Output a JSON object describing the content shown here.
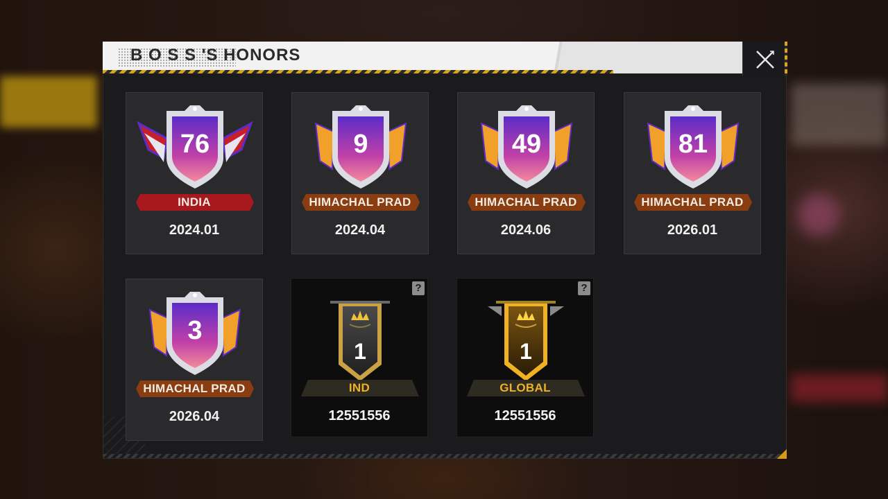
{
  "window": {
    "title": "B O S S 'S HONORS",
    "close_icon": "close-icon"
  },
  "colors": {
    "accent_gold": "#d8a51a",
    "ribbon_red": "#a8191e",
    "ribbon_orange": "#8a3d10",
    "badge_purple": "#6a2fc4",
    "badge_pink": "#e05a9e"
  },
  "honors": [
    {
      "rank": "76",
      "region": "INDIA",
      "date": "2024.01",
      "style": "red-wings"
    },
    {
      "rank": "9",
      "region": "HIMACHAL PRAD",
      "date": "2024.04",
      "style": "gold-wings"
    },
    {
      "rank": "49",
      "region": "HIMACHAL PRAD",
      "date": "2024.06",
      "style": "gold-wings"
    },
    {
      "rank": "81",
      "region": "HIMACHAL PRAD",
      "date": "2026.01",
      "style": "gold-wings"
    },
    {
      "rank": "3",
      "region": "HIMACHAL PRAD",
      "date": "2026.04",
      "style": "gold-wings"
    },
    {
      "rank": "1",
      "region": "IND",
      "date": "12551556",
      "style": "crown-banner",
      "help": "?"
    },
    {
      "rank": "1",
      "region": "GLOBAL",
      "date": "12551556",
      "style": "crown-banner-gold",
      "help": "?"
    }
  ]
}
